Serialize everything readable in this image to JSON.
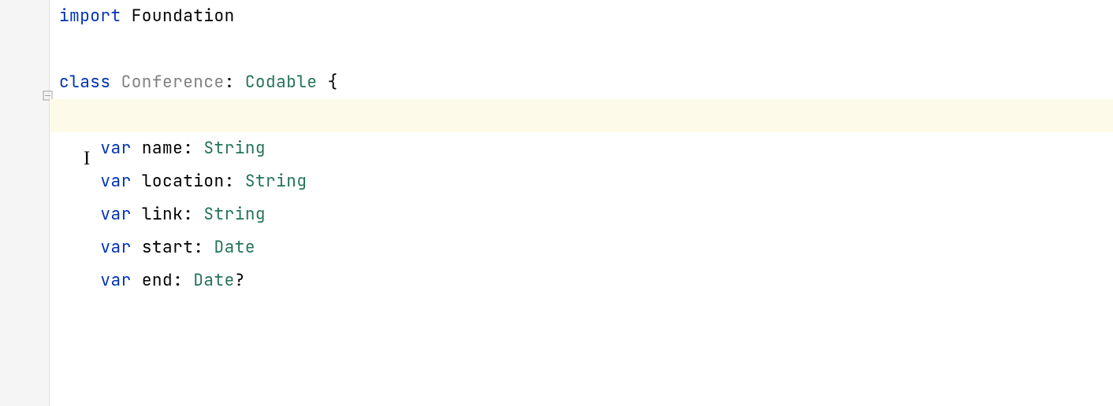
{
  "code": {
    "line1": {
      "import_kw": "import",
      "module": " Foundation"
    },
    "line2": "",
    "line3": {
      "class_kw": "class",
      "class_name": " Conference",
      "colon": ": ",
      "protocol": "Codable",
      "brace": " {"
    },
    "line4": "",
    "line5": {
      "indent": "    ",
      "var_kw": "var",
      "name": " name",
      "colon": ": ",
      "type": "String"
    },
    "line6": {
      "indent": "    ",
      "var_kw": "var",
      "name": " location",
      "colon": ": ",
      "type": "String"
    },
    "line7": {
      "indent": "    ",
      "var_kw": "var",
      "name": " link",
      "colon": ": ",
      "type": "String"
    },
    "line8": {
      "indent": "    ",
      "var_kw": "var",
      "name": " start",
      "colon": ": ",
      "type": "Date"
    },
    "line9": {
      "indent": "    ",
      "var_kw": "var",
      "name": " end",
      "colon": ": ",
      "type": "Date",
      "optional": "?"
    }
  }
}
